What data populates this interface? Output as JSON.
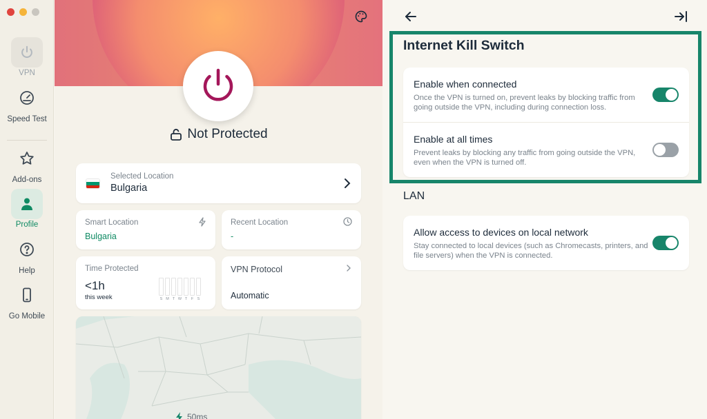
{
  "sidebar": {
    "items": [
      {
        "label": "VPN",
        "icon": "power-icon"
      },
      {
        "label": "Speed Test",
        "icon": "speedometer-icon"
      },
      {
        "label": "Add-ons",
        "icon": "star-icon"
      },
      {
        "label": "Profile",
        "icon": "person-icon"
      },
      {
        "label": "Help",
        "icon": "question-icon"
      },
      {
        "label": "Go Mobile",
        "icon": "phone-icon"
      }
    ],
    "active": "Profile"
  },
  "main": {
    "status": "Not Protected",
    "selected_location": {
      "label": "Selected Location",
      "value": "Bulgaria"
    },
    "smart_location": {
      "label": "Smart Location",
      "value": "Bulgaria"
    },
    "recent_location": {
      "label": "Recent Location",
      "value": "-"
    },
    "time_protected": {
      "label": "Time Protected",
      "value": "<1h",
      "period": "this week",
      "days": [
        "S",
        "M",
        "T",
        "W",
        "T",
        "F",
        "S"
      ]
    },
    "vpn_protocol": {
      "label": "VPN Protocol",
      "value": "Automatic"
    },
    "map": {
      "latency": "50ms"
    }
  },
  "settings": {
    "kill_switch": {
      "title": "Internet Kill Switch",
      "options": [
        {
          "title": "Enable when connected",
          "desc": "Once the VPN is turned on, prevent leaks by blocking traffic from going outside the VPN, including during connection loss.",
          "enabled": true
        },
        {
          "title": "Enable at all times",
          "desc": "Prevent leaks by blocking any traffic from going outside the VPN, even when the VPN is turned off.",
          "enabled": false
        }
      ]
    },
    "lan": {
      "title": "LAN",
      "options": [
        {
          "title": "Allow access to devices on local network",
          "desc": "Stay connected to local devices (such as Chromecasts, printers, and file servers) when the VPN is connected.",
          "enabled": true
        }
      ]
    }
  },
  "colors": {
    "accent": "#17856a",
    "power": "#a4175a",
    "hero": "#e88970",
    "toggle_off": "#9aa1a7"
  },
  "flag_colors": [
    "#ffffff",
    "#00966e",
    "#d62612"
  ]
}
